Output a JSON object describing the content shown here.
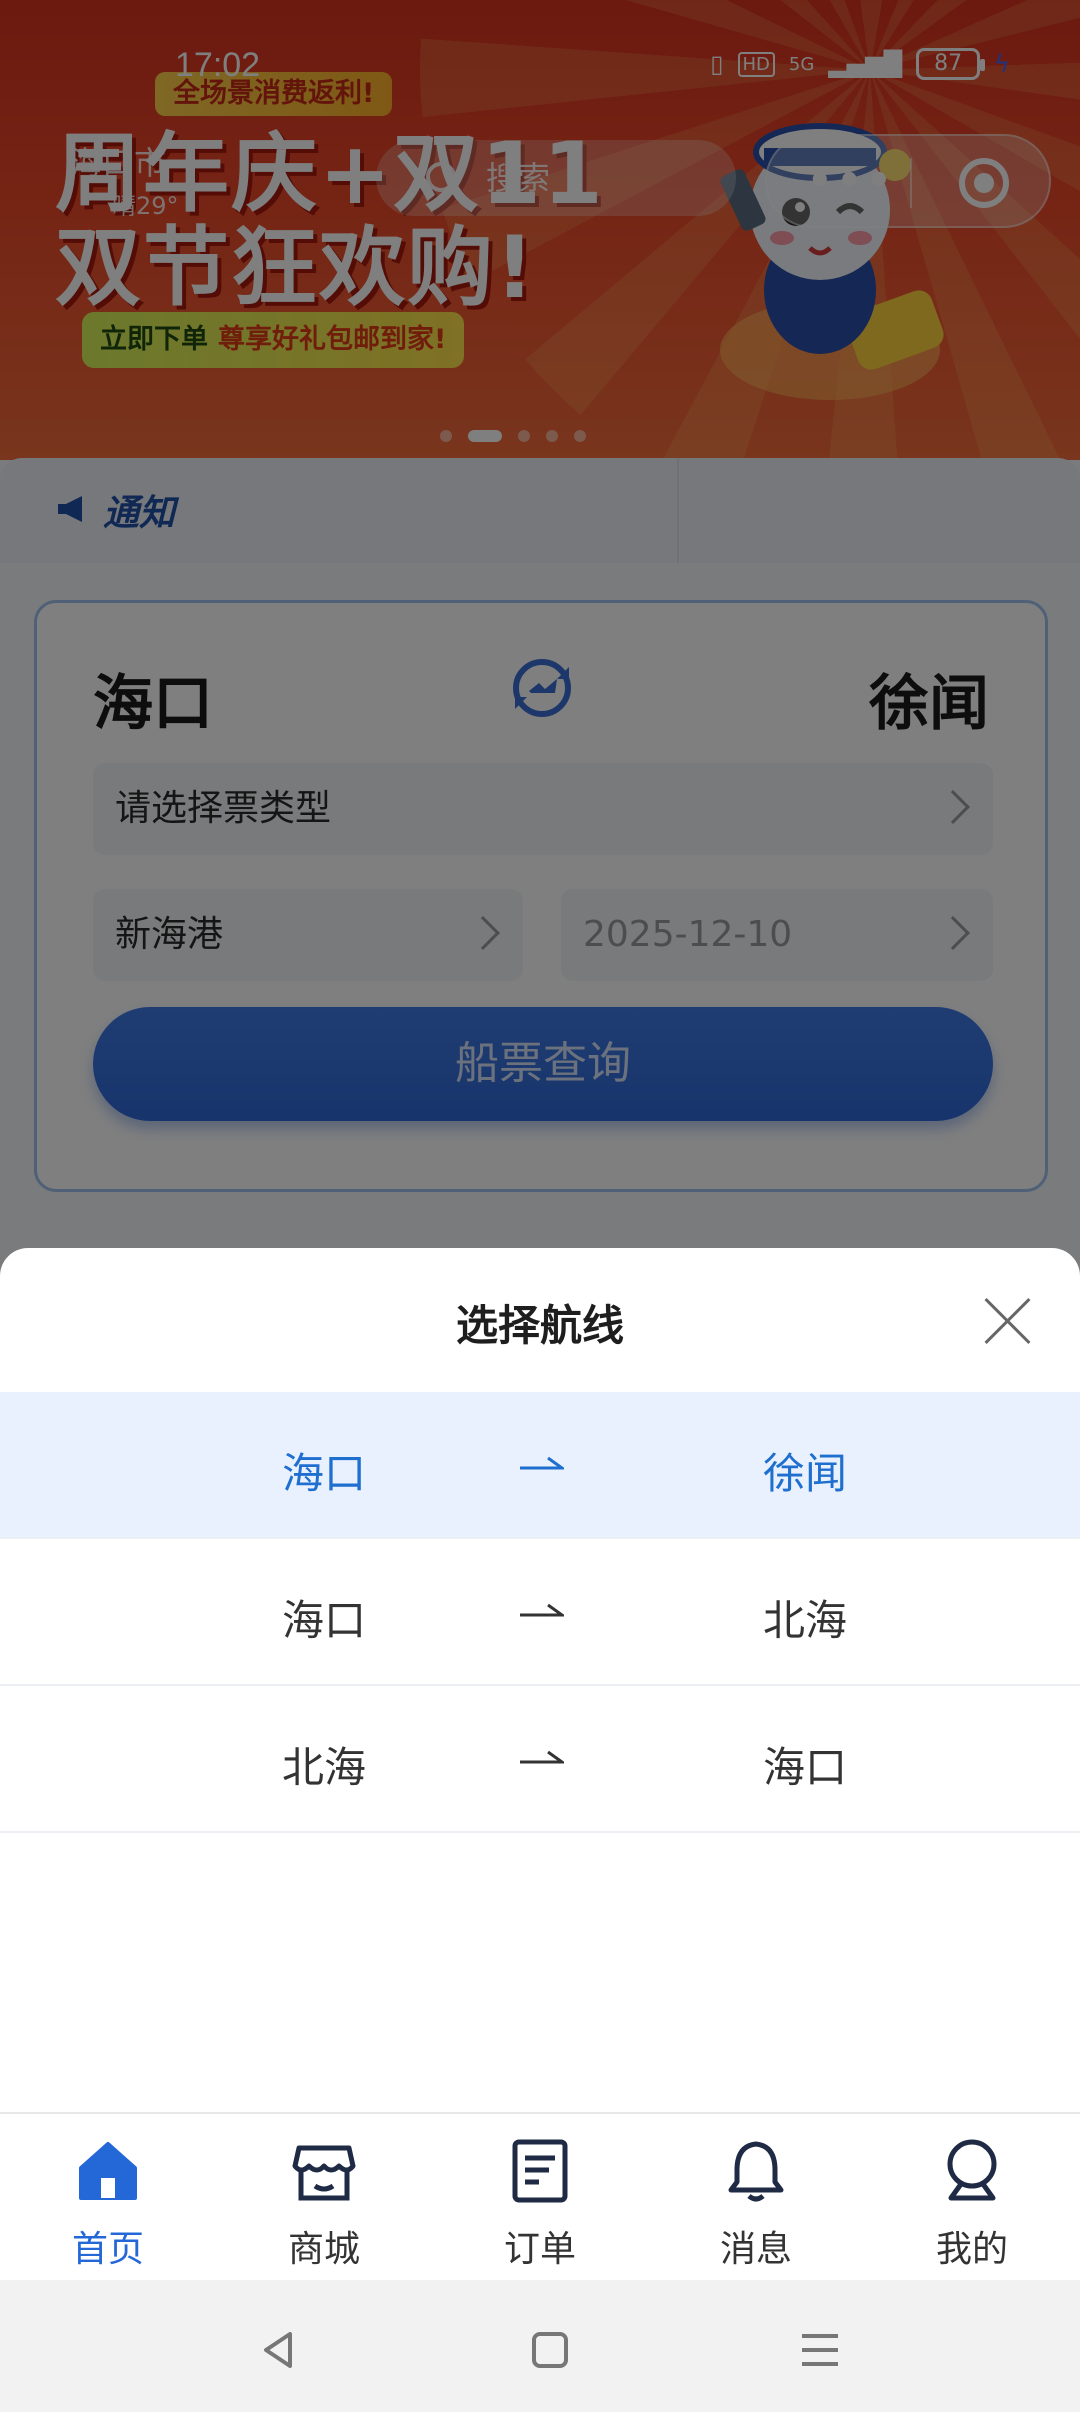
{
  "status_bar": {
    "time": "17:02",
    "network": "5G",
    "hd": "HD",
    "battery": "87"
  },
  "banner": {
    "promo_tag": "全场景消费返利!",
    "title_line1": "周年庆+双11",
    "title_line2": "双节狂欢购!",
    "sub_prefix": "立即下单",
    "sub_highlight": "尊享好礼包邮到家!",
    "slide_count": 5,
    "active_slide": 1
  },
  "header": {
    "city": "海口市",
    "weather": "晴29°",
    "search_placeholder": "搜索"
  },
  "notice": {
    "label": "通知"
  },
  "booking": {
    "from_port": "海口",
    "to_port": "徐闻",
    "ticket_type_placeholder": "请选择票类型",
    "departure_port": "新海港",
    "date": "2025-12-10",
    "query_button": "船票查询"
  },
  "route_sheet": {
    "title": "选择航线",
    "routes": [
      {
        "from": "海口",
        "to": "徐闻",
        "selected": true
      },
      {
        "from": "海口",
        "to": "北海",
        "selected": false
      },
      {
        "from": "北海",
        "to": "海口",
        "selected": false
      }
    ]
  },
  "tabbar": {
    "items": [
      {
        "label": "首页",
        "icon": "home-icon",
        "active": true
      },
      {
        "label": "商城",
        "icon": "store-icon",
        "active": false
      },
      {
        "label": "订单",
        "icon": "order-icon",
        "active": false
      },
      {
        "label": "消息",
        "icon": "bell-icon",
        "active": false
      },
      {
        "label": "我的",
        "icon": "profile-icon",
        "active": false
      }
    ]
  },
  "colors": {
    "accent": "#2468d8",
    "selected_row_bg": "#e8f1fd",
    "banner_red": "#e23b1f"
  }
}
